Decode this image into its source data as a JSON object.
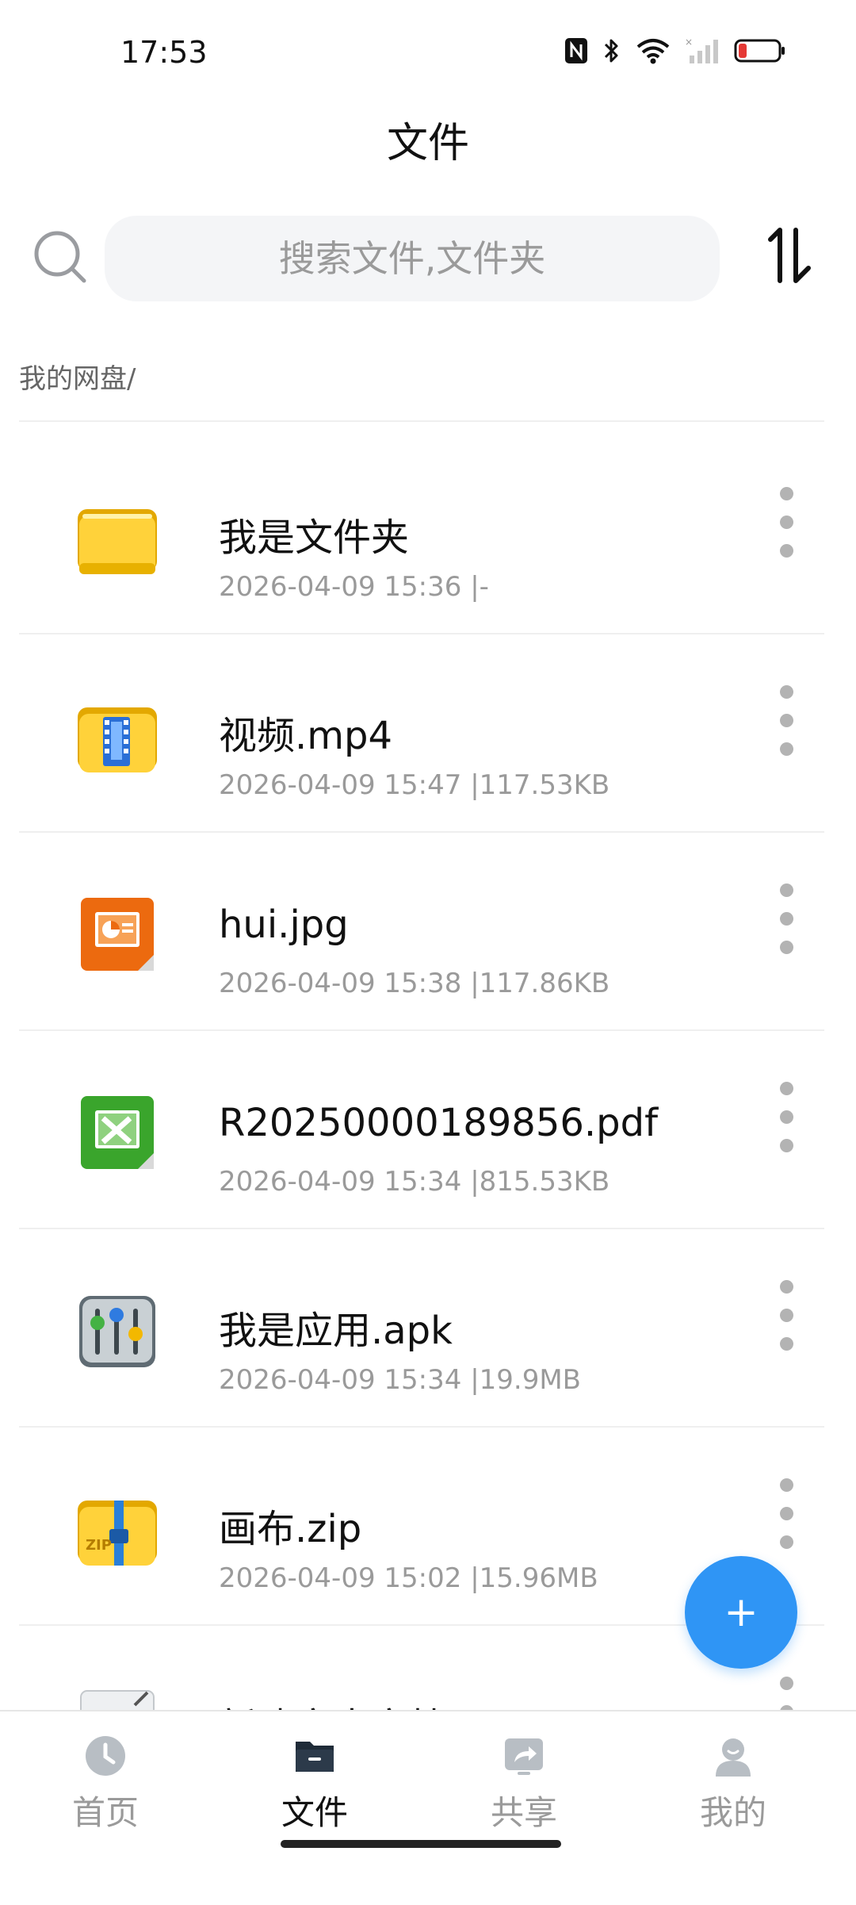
{
  "status_bar": {
    "time": "17:53"
  },
  "header": {
    "title": "文件"
  },
  "search": {
    "placeholder": "搜索文件,文件夹"
  },
  "breadcrumb": "我的网盘/",
  "files": [
    {
      "name": "我是文件夹",
      "meta": "2026-04-09 15:36 |-",
      "icon": "folder-icon"
    },
    {
      "name": "视频.mp4",
      "meta": "2026-04-09 15:47 |117.53KB",
      "icon": "video-folder-icon"
    },
    {
      "name": "hui.jpg",
      "meta": "2026-04-09 15:38 |117.86KB",
      "icon": "presentation-file-icon"
    },
    {
      "name": "R20250000189856.pdf",
      "meta": "2026-04-09 15:34 |815.53KB",
      "icon": "spreadsheet-file-icon"
    },
    {
      "name": "我是应用.apk",
      "meta": "2026-04-09 15:34 |19.9MB",
      "icon": "app-package-icon"
    },
    {
      "name": "画布.zip",
      "meta": "2026-04-09 15:02 |15.96MB",
      "icon": "zip-archive-icon"
    },
    {
      "name": "新建文本文档.txt",
      "meta": "",
      "icon": "text-file-icon"
    }
  ],
  "fab": {
    "label": "+"
  },
  "bottom_nav": [
    {
      "label": "首页",
      "icon": "clock-icon",
      "active": false
    },
    {
      "label": "文件",
      "icon": "folder-nav-icon",
      "active": true
    },
    {
      "label": "共享",
      "icon": "share-icon",
      "active": false
    },
    {
      "label": "我的",
      "icon": "user-icon",
      "active": false
    }
  ],
  "colors": {
    "accent": "#2f95f5",
    "text": "#111111",
    "muted": "#9a9a9a"
  }
}
